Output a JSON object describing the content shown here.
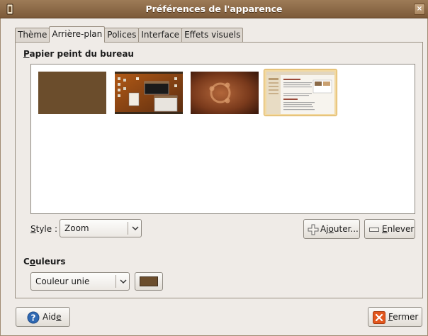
{
  "window": {
    "title": "Préférences de l'apparence",
    "close_glyph": "×"
  },
  "tabs": [
    {
      "label": "Thème"
    },
    {
      "label": "Arrière-plan"
    },
    {
      "label": "Polices"
    },
    {
      "label": "Interface"
    },
    {
      "label": "Effets visuels"
    }
  ],
  "active_tab": "Arrière-plan",
  "background": {
    "section_title_initial": "P",
    "section_title_rest": "apier peint du bureau",
    "wallpapers": [
      {
        "name": "solid-brown-wallpaper",
        "selected": false
      },
      {
        "name": "desktop-screenshot-wallpaper",
        "selected": false
      },
      {
        "name": "ubuntu-logo-wallpaper",
        "selected": false
      },
      {
        "name": "document-screenshot-wallpaper",
        "selected": true
      }
    ],
    "style_label_initial": "S",
    "style_label_rest": "tyle :",
    "style_value": "Zoom",
    "add_button_pre": "Aj",
    "add_button_u": "o",
    "add_button_post": "uter...",
    "remove_button_initial": "E",
    "remove_button_rest": "nlever"
  },
  "colors": {
    "section_title_pre": "C",
    "section_title_u": "o",
    "section_title_post": "uleurs",
    "fill_value": "Couleur unie",
    "swatch_color": "#6b4d2c"
  },
  "footer": {
    "help_pre": "Aid",
    "help_u": "e",
    "close_initial": "F",
    "close_rest": "ermer"
  },
  "theme_colors": {
    "titlebar": "#8b6a48",
    "selection": "#f2d9a2",
    "window_bg": "#efebe7"
  }
}
